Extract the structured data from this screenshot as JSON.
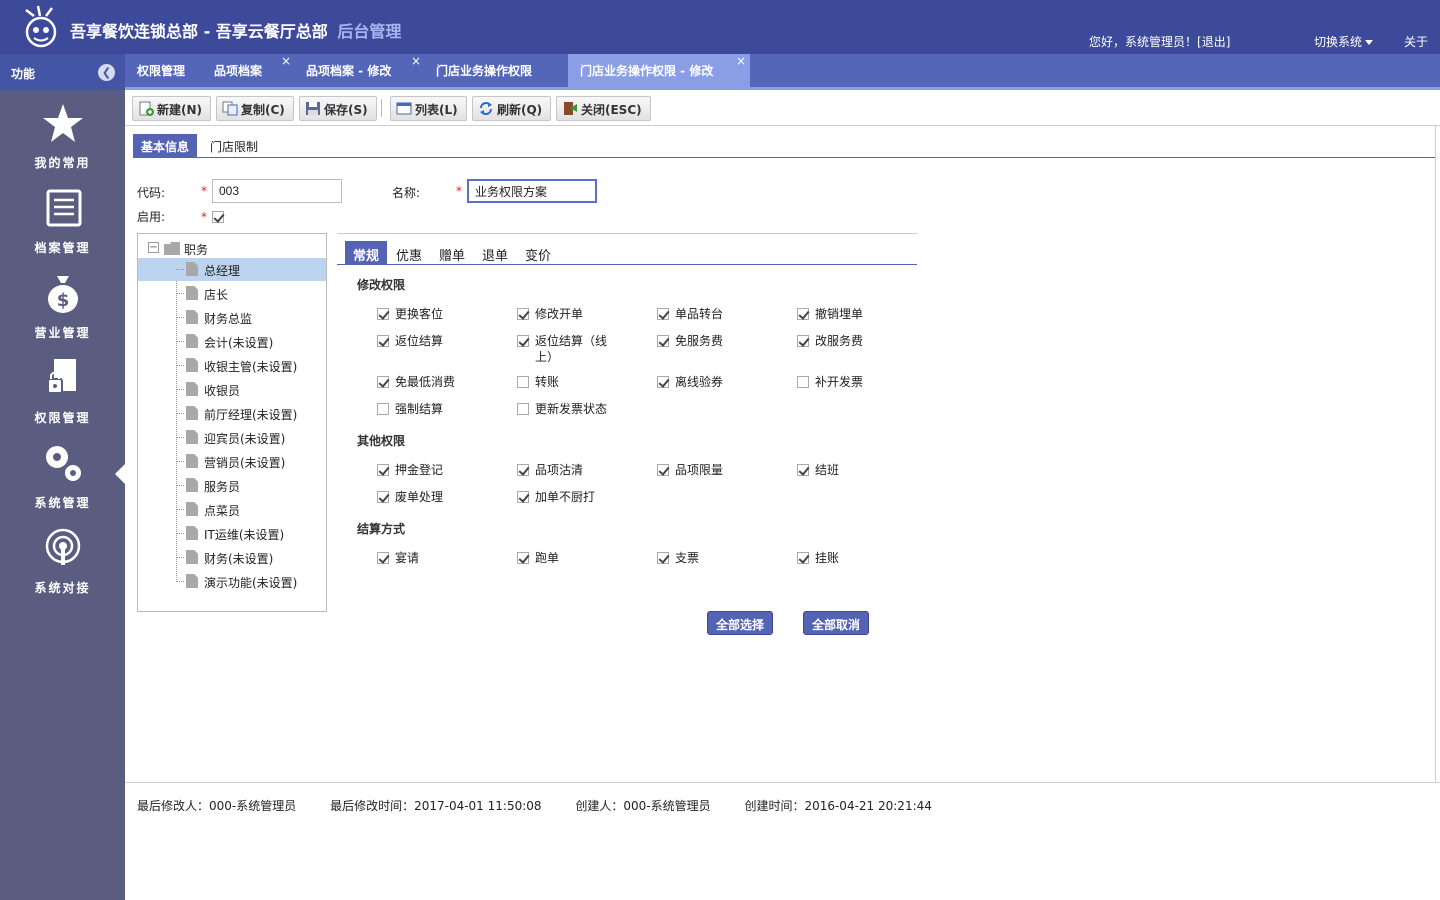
{
  "header": {
    "app_title": "吾享餐饮连锁总部 - 吾享云餐厅总部",
    "app_subtitle": "后台管理",
    "greeting": "您好，系统管理员！[",
    "logout": "退出",
    "greeting_end": "]",
    "switch_system": "切换系统",
    "about": "关于",
    "colors": {
      "header_bg": "#3c4a99",
      "tab_bg": "#5466b8",
      "accent": "#5563b3"
    }
  },
  "tabbar": {
    "func_label": "功能",
    "tabs": [
      {
        "label": "权限管理",
        "closable": false,
        "active": false
      },
      {
        "label": "品项档案",
        "closable": true,
        "active": false
      },
      {
        "label": "品项档案 - 修改",
        "closable": true,
        "active": false
      },
      {
        "label": "门店业务操作权限",
        "closable": false,
        "active": false
      },
      {
        "label": "门店业务操作权限 - 修改",
        "closable": true,
        "active": true
      }
    ],
    "close_glyph": "×"
  },
  "sidebar": {
    "items": [
      {
        "label": "我的常用",
        "icon": "star-icon"
      },
      {
        "label": "档案管理",
        "icon": "document-list-icon"
      },
      {
        "label": "营业管理",
        "icon": "money-bag-icon"
      },
      {
        "label": "权限管理",
        "icon": "lock-paper-icon",
        "active": true
      },
      {
        "label": "系统管理",
        "icon": "gears-icon"
      },
      {
        "label": "系统对接",
        "icon": "broadcast-icon"
      }
    ]
  },
  "toolbar": {
    "buttons": [
      {
        "label": "新建(N)",
        "icon": "new-icon"
      },
      {
        "label": "复制(C)",
        "icon": "copy-icon"
      },
      {
        "label": "保存(S)",
        "icon": "save-icon"
      },
      {
        "label": "列表(L)",
        "icon": "list-icon"
      },
      {
        "label": "刷新(Q)",
        "icon": "refresh-icon"
      },
      {
        "label": "关闭(ESC)",
        "icon": "close-door-icon"
      }
    ]
  },
  "form_tabs": [
    {
      "label": "基本信息",
      "active": true
    },
    {
      "label": "门店限制",
      "active": false
    }
  ],
  "form": {
    "code_label": "代码:",
    "code_value": "003",
    "name_label": "名称:",
    "name_value": "业务权限方案",
    "enabled_label": "启用:",
    "enabled": true,
    "required_mark": "*"
  },
  "tree": {
    "root": "职务",
    "collapse_glyph": "−",
    "nodes": [
      {
        "label": "总经理",
        "selected": true
      },
      {
        "label": "店长"
      },
      {
        "label": "财务总监"
      },
      {
        "label": "会计(未设置)"
      },
      {
        "label": "收银主管(未设置)"
      },
      {
        "label": "收银员"
      },
      {
        "label": "前厅经理(未设置)"
      },
      {
        "label": "迎宾员(未设置)"
      },
      {
        "label": "营销员(未设置)"
      },
      {
        "label": "服务员"
      },
      {
        "label": "点菜员"
      },
      {
        "label": "IT运维(未设置)"
      },
      {
        "label": "财务(未设置)"
      },
      {
        "label": "演示功能(未设置)"
      }
    ]
  },
  "perm_tabs": [
    {
      "label": "常规",
      "active": true
    },
    {
      "label": "优惠"
    },
    {
      "label": "赠单"
    },
    {
      "label": "退单"
    },
    {
      "label": "变价"
    }
  ],
  "sections": [
    {
      "title": "修改权限",
      "items": [
        {
          "label": "更换客位",
          "checked": true
        },
        {
          "label": "修改开单",
          "checked": true
        },
        {
          "label": "单品转台",
          "checked": true
        },
        {
          "label": "撤销埋单",
          "checked": true
        },
        {
          "label": "返位结算",
          "checked": true
        },
        {
          "label": "返位结算（线上）",
          "checked": true
        },
        {
          "label": "免服务费",
          "checked": true
        },
        {
          "label": "改服务费",
          "checked": true
        },
        {
          "label": "免最低消费",
          "checked": true
        },
        {
          "label": "转账",
          "checked": false
        },
        {
          "label": "离线验券",
          "checked": true
        },
        {
          "label": "补开发票",
          "checked": false
        },
        {
          "label": "强制结算",
          "checked": false
        },
        {
          "label": "更新发票状态",
          "checked": false
        }
      ]
    },
    {
      "title": "其他权限",
      "items": [
        {
          "label": "押金登记",
          "checked": true
        },
        {
          "label": "品项沽清",
          "checked": true
        },
        {
          "label": "品项限量",
          "checked": true
        },
        {
          "label": "结班",
          "checked": true
        },
        {
          "label": "废单处理",
          "checked": true
        },
        {
          "label": "加单不厨打",
          "checked": true
        }
      ]
    },
    {
      "title": "结算方式",
      "items": [
        {
          "label": "宴请",
          "checked": true
        },
        {
          "label": "跑单",
          "checked": true
        },
        {
          "label": "支票",
          "checked": true
        },
        {
          "label": "挂账",
          "checked": true
        }
      ]
    }
  ],
  "actions": {
    "select_all": "全部选择",
    "cancel_all": "全部取消"
  },
  "footer": {
    "last_modifier": "最后修改人：000-系统管理员",
    "last_modified_time": "最后修改时间：2017-04-01 11:50:08",
    "creator": "创建人：000-系统管理员",
    "created_time": "创建时间：2016-04-21 20:21:44"
  }
}
